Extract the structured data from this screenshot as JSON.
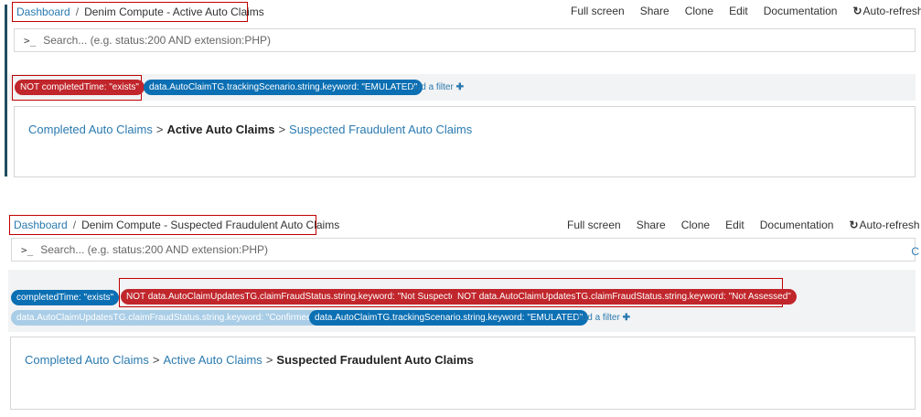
{
  "panel_a": {
    "breadcrumb": {
      "root": "Dashboard",
      "separator": "/",
      "title": "Denim Compute - Active Auto Claims"
    },
    "menu": [
      "Full screen",
      "Share",
      "Clone",
      "Edit",
      "Documentation",
      "Auto-refresh"
    ],
    "search": {
      "prompt": ">_",
      "placeholder": "Search... (e.g. status:200 AND extension:PHP)"
    },
    "filters": [
      {
        "label": "NOT completedTime: \"exists\"",
        "style": "negated"
      },
      {
        "label": "data.AutoClaimTG.trackingScenario.string.keyword: \"EMULATED\"",
        "style": "active"
      }
    ],
    "add_filter": "Add a filter",
    "nav": {
      "link1": "Completed Auto Claims",
      "sep": ">",
      "current": "Active Auto Claims",
      "link2": "Suspected Fraudulent Auto Claims"
    }
  },
  "panel_b": {
    "breadcrumb": {
      "root": "Dashboard",
      "separator": "/",
      "title": "Denim Compute - Suspected Fraudulent Auto Claims"
    },
    "menu": [
      "Full screen",
      "Share",
      "Clone",
      "Edit",
      "Documentation",
      "Auto-refresh"
    ],
    "search": {
      "prompt": ">_",
      "placeholder": "Search... (e.g. status:200 AND extension:PHP)"
    },
    "edge_glyph": "C",
    "filters": [
      {
        "label": "completedTime: \"exists\"",
        "style": "active"
      },
      {
        "label": "NOT data.AutoClaimUpdatesTG.claimFraudStatus.string.keyword: \"Not Suspected\"",
        "style": "negated"
      },
      {
        "label": "NOT data.AutoClaimUpdatesTG.claimFraudStatus.string.keyword: \"Not Assessed\"",
        "style": "negated"
      },
      {
        "label": "data.AutoClaimUpdatesTG.claimFraudStatus.string.keyword: \"Confirmed\"",
        "style": "disabled"
      },
      {
        "label": "data.AutoClaimTG.trackingScenario.string.keyword: \"EMULATED\"",
        "style": "active"
      }
    ],
    "add_filter": "Add a filter",
    "nav": {
      "link1": "Completed Auto Claims",
      "sep": ">",
      "link2": "Active Auto Claims",
      "current": "Suspected Fraudulent Auto Claims"
    }
  },
  "colors": {
    "link": "#2a7ab0",
    "pill_active": "#0b6fb3",
    "pill_negated": "#c0262b",
    "pill_disabled": "#a9cde6",
    "highlight_box": "#c00000"
  },
  "icons": {
    "refresh": "refresh-icon",
    "plus": "plus-icon",
    "prompt": "terminal-prompt-icon"
  }
}
